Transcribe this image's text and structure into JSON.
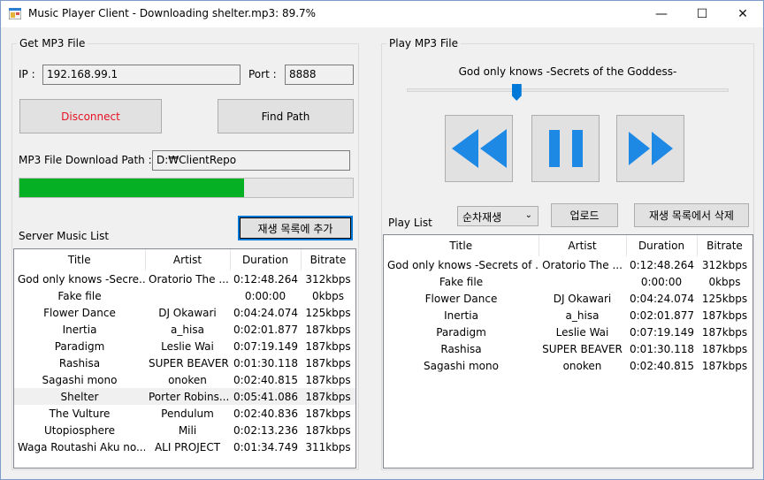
{
  "window": {
    "title": "Music Player Client - Downloading shelter.mp3: 89.7%",
    "minimize": "—",
    "maximize": "☐",
    "close": "✕"
  },
  "get_group": {
    "title": "Get MP3 File",
    "ip_label": "IP :",
    "ip_value": "192.168.99.1",
    "port_label": "Port :",
    "port_value": "8888",
    "disconnect_label": "Disconnect",
    "find_path_label": "Find Path",
    "download_path_label": "MP3 File Download Path :",
    "download_path_value": "D:₩ClientRepo",
    "progress": 0.675,
    "add_to_playlist_label": "재생 목록에 추가",
    "server_list_label": "Server Music List"
  },
  "play_group": {
    "title": "Play MP3 File",
    "now_playing": "God only knows -Secrets of the Goddess-",
    "seek_position": 0.34,
    "play_mode": "순차재생",
    "upload_label": "업로드",
    "delete_label": "재생 목록에서 삭제",
    "playlist_label": "Play List"
  },
  "columns": [
    "Title",
    "Artist",
    "Duration",
    "Bitrate"
  ],
  "server_songs": [
    [
      "God only knows -Secre...",
      "Oratorio The ...",
      "0:12:48.264",
      "312kbps"
    ],
    [
      "Fake file",
      "",
      "0:00:00",
      "0kbps"
    ],
    [
      "Flower Dance",
      "DJ Okawari",
      "0:04:24.074",
      "125kbps"
    ],
    [
      "Inertia",
      "a_hisa",
      "0:02:01.877",
      "187kbps"
    ],
    [
      "Paradigm",
      "Leslie Wai",
      "0:07:19.149",
      "187kbps"
    ],
    [
      "Rashisa",
      "SUPER BEAVER",
      "0:01:30.118",
      "187kbps"
    ],
    [
      "Sagashi mono",
      "onoken",
      "0:02:40.815",
      "187kbps"
    ],
    [
      "Shelter",
      "Porter Robins...",
      "0:05:41.086",
      "187kbps"
    ],
    [
      "The Vulture",
      "Pendulum",
      "0:02:40.836",
      "187kbps"
    ],
    [
      "Utopiosphere",
      "Mili",
      "0:02:13.236",
      "187kbps"
    ],
    [
      "Waga Routashi Aku no...",
      "ALI PROJECT",
      "0:01:34.749",
      "311kbps"
    ]
  ],
  "playlist_songs": [
    [
      "God only knows -Secrets of ...",
      "Oratorio The ...",
      "0:12:48.264",
      "312kbps"
    ],
    [
      "Fake file",
      "",
      "0:00:00",
      "0kbps"
    ],
    [
      "Flower Dance",
      "DJ Okawari",
      "0:04:24.074",
      "125kbps"
    ],
    [
      "Inertia",
      "a_hisa",
      "0:02:01.877",
      "187kbps"
    ],
    [
      "Paradigm",
      "Leslie Wai",
      "0:07:19.149",
      "187kbps"
    ],
    [
      "Rashisa",
      "SUPER BEAVER",
      "0:01:30.118",
      "187kbps"
    ],
    [
      "Sagashi mono",
      "onoken",
      "0:02:40.815",
      "187kbps"
    ]
  ],
  "colors": {
    "accent": "#0078d7",
    "progress": "#06b025",
    "media_icon": "#1e88e5",
    "disconnect_text": "#e81123"
  }
}
